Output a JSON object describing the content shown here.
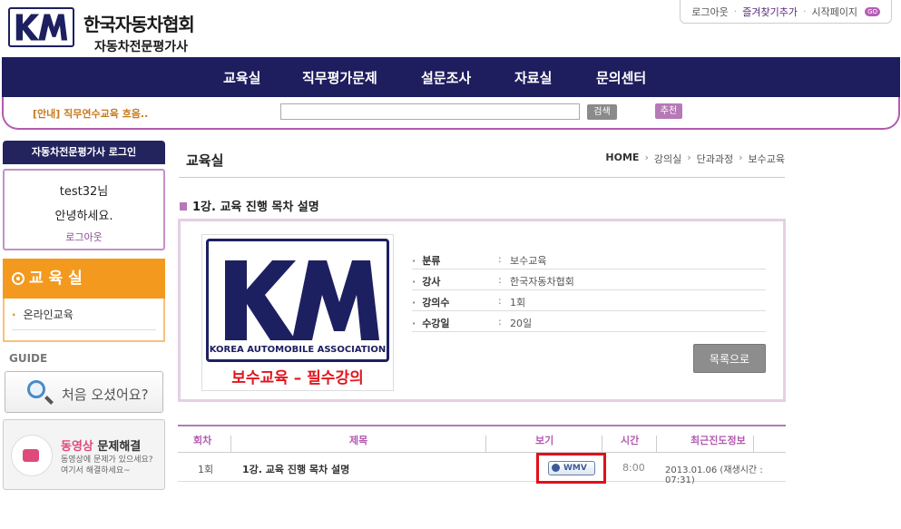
{
  "header": {
    "logo_line1": "한국자동차협회",
    "logo_line2": "자동차전문평가사",
    "toplinks": {
      "logout": "로그아웃",
      "favorite": "즐겨찾기추가",
      "homepage": "시작페이지",
      "go": "GO"
    }
  },
  "nav": [
    "교육실",
    "직무평가문제",
    "설문조사",
    "자료실",
    "문의센터"
  ],
  "subbar": {
    "notice": "[안내] 직무연수교육 흐음..",
    "search_label": "검색",
    "recommend_label": "추천"
  },
  "sidebar": {
    "login_title": "자동차전문평가사 로그인",
    "user": "test32님",
    "greeting": "안녕하세요.",
    "logout": "로그아웃",
    "section_title": "교 육 실",
    "menu": [
      "온라인교육"
    ],
    "guide_label": "GUIDE",
    "guide_button": "처음 오셨어요?",
    "video_title_hl": "동영상",
    "video_title_rest": " 문제해결",
    "video_desc1": "동영상에 문제가 있으세요?",
    "video_desc2": "여기서 해결하세요~"
  },
  "main": {
    "page_title": "교육실",
    "breadcrumb": [
      "HOME",
      "강의실",
      "단과과정",
      "보수교육"
    ],
    "lesson_title": "1강. 교육 진행 목차 설명",
    "thumb": {
      "association": "KOREA AUTOMOBILE ASSOCIATION",
      "caption": "보수교육 – 필수강의"
    },
    "info": [
      {
        "key": "분류",
        "value": "보수교육"
      },
      {
        "key": "강사",
        "value": "한국자동차협회"
      },
      {
        "key": "강의수",
        "value": "1회"
      },
      {
        "key": "수강일",
        "value": "20일"
      }
    ],
    "list_button": "목록으로",
    "table": {
      "headers": [
        "회차",
        "제목",
        "보기",
        "시간",
        "최근진도정보"
      ],
      "rows": [
        {
          "no": "1회",
          "title": "1강. 교육 진행 목차 설명",
          "view": "WMV",
          "time": "8:00",
          "progress": "2013.01.06 (재생시간 : 07:31)"
        }
      ]
    }
  },
  "colors": {
    "navy": "#1e1d5e",
    "purple": "#b35bb0",
    "orange": "#f39a1e",
    "highlight_red": "#e0101a"
  }
}
